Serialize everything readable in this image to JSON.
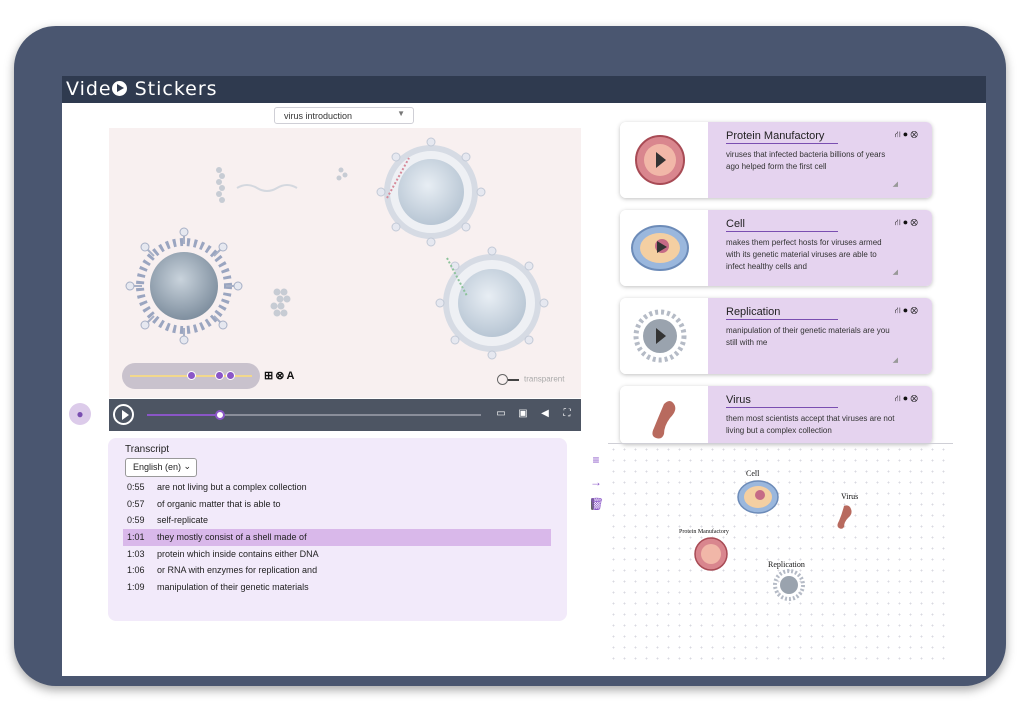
{
  "app": {
    "title_prefix": "Vide",
    "title_suffix": "Stickers"
  },
  "video": {
    "selected_video": "virus introduction",
    "progress": 0.22,
    "transparent_label": "transparent",
    "controls": [
      "subtitles-icon",
      "picture-in-picture-icon",
      "volume-icon",
      "fullscreen-icon"
    ]
  },
  "sticker_controls": {
    "knob_positions": [
      0.5,
      0.73,
      0.82
    ],
    "mini_label": "A"
  },
  "transcript": {
    "heading": "Transcript",
    "language": "English (en)",
    "rows": [
      {
        "time": "0:55",
        "text": "are not living but a complex collection",
        "active": false
      },
      {
        "time": "0:57",
        "text": "of organic matter that is able to",
        "active": false
      },
      {
        "time": "0:59",
        "text": "self-replicate",
        "active": false
      },
      {
        "time": "1:01",
        "text": "they mostly consist of a shell made of",
        "active": true
      },
      {
        "time": "1:03",
        "text": "protein which inside contains either DNA",
        "active": false
      },
      {
        "time": "1:06",
        "text": "or RNA with enzymes for replication and",
        "active": false
      },
      {
        "time": "1:09",
        "text": "manipulation of their genetic materials",
        "active": false
      }
    ]
  },
  "cards": [
    {
      "title": "Protein Manufactory",
      "desc": "viruses that infected bacteria billions of years ago helped form the first cell"
    },
    {
      "title": "Cell",
      "desc": "makes them perfect hosts for viruses armed with its genetic material viruses are able to infect healthy cells and"
    },
    {
      "title": "Replication",
      "desc": "manipulation of their genetic materials are you still with me"
    },
    {
      "title": "Virus",
      "desc": "them most scientists accept that viruses are not living but a complex collection"
    }
  ],
  "graph": {
    "nodes": [
      "Cell",
      "Virus",
      "Protein Manufactory",
      "Replication"
    ]
  },
  "colors": {
    "frame": "#4a5670",
    "titlebar": "#2f3a4f",
    "accent": "#8a56c7",
    "card_body": "#e5d3ef",
    "transcript_bg": "#f2eafa",
    "active_row": "#d9b8ea"
  }
}
